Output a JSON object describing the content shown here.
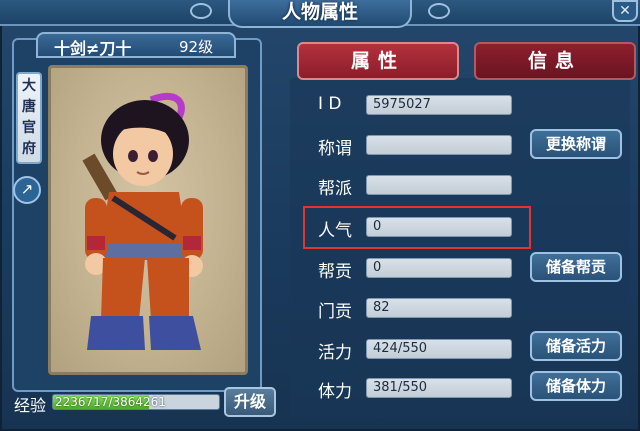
{
  "window": {
    "title": "人物属性",
    "close_icon": "close-icon"
  },
  "character": {
    "name": "十剑≠刀十",
    "level": "92级",
    "faction": "大唐官府",
    "share_icon": "share-icon"
  },
  "experience": {
    "label": "经验",
    "text": "2236717/3864261",
    "current": 2236717,
    "max": 3864261
  },
  "upgrade_label": "升级",
  "tabs": {
    "attributes": "属性",
    "info": "信息"
  },
  "fields": [
    {
      "label": "I D",
      "value": "5975027",
      "button": ""
    },
    {
      "label": "称谓",
      "value": "",
      "button": "更换称谓"
    },
    {
      "label": "帮派",
      "value": "",
      "button": ""
    },
    {
      "label": "人气",
      "value": "0",
      "button": ""
    },
    {
      "label": "帮贡",
      "value": "0",
      "button": "储备帮贡"
    },
    {
      "label": "门贡",
      "value": "82",
      "button": ""
    },
    {
      "label": "活力",
      "value": "424/550",
      "button": "储备活力"
    },
    {
      "label": "体力",
      "value": "381/550",
      "button": "储备体力"
    }
  ],
  "colors": {
    "highlight": "#e1362e",
    "tab_active": "#b3313d",
    "exp_fill": "#5cc23a"
  }
}
